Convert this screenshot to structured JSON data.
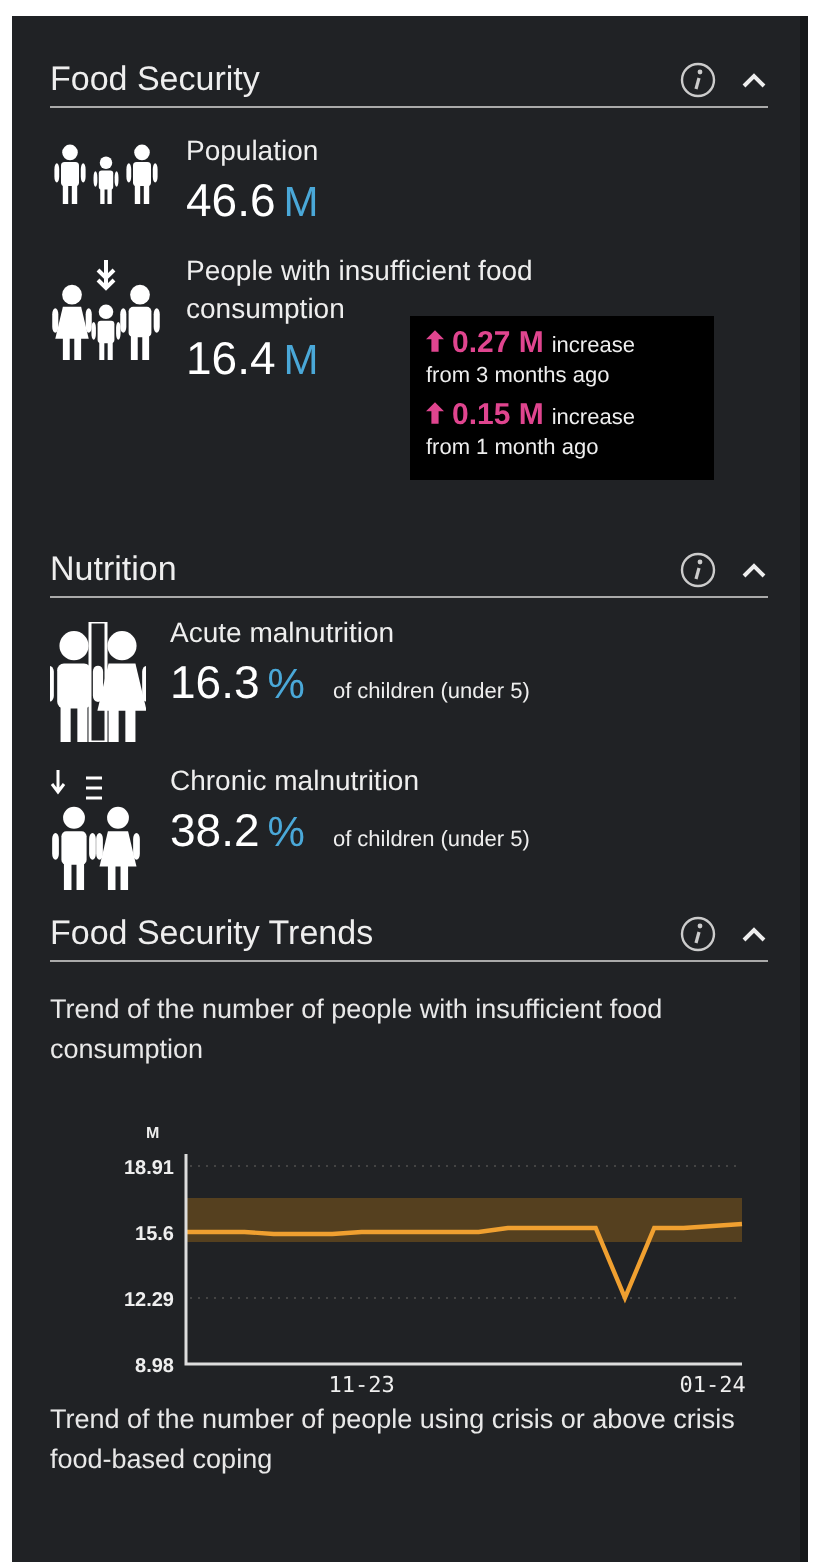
{
  "sections": [
    {
      "title": "Food Security",
      "kind": "stats",
      "items": [
        {
          "label": "Population",
          "value": "46.6",
          "unit": "M"
        },
        {
          "label": "People with insufficient food consumption",
          "value": "16.4",
          "unit": "M",
          "tooltip": [
            {
              "amount": "0.27 M",
              "word": "increase",
              "period": "from 3 months ago"
            },
            {
              "amount": "0.15 M",
              "word": "increase",
              "period": "from 1 month ago"
            }
          ]
        }
      ]
    },
    {
      "title": "Nutrition",
      "kind": "stats",
      "items": [
        {
          "label": "Acute malnutrition",
          "value": "16.3",
          "unit": "%",
          "note": "of children (under 5)"
        },
        {
          "label": "Chronic malnutrition",
          "value": "38.2",
          "unit": "%",
          "note": "of children (under 5)"
        }
      ]
    },
    {
      "title": "Food Security Trends",
      "kind": "trends",
      "charts": [
        {
          "caption": "Trend of the number of people with insufficient food consumption",
          "chart_data": {
            "type": "line",
            "ylabel": "M",
            "categories": [
              null,
              null,
              null,
              null,
              null,
              null,
              "11-23",
              null,
              null,
              null,
              null,
              null,
              null,
              null,
              null,
              null,
              null,
              null,
              "01-24",
              null
            ],
            "series": [
              {
                "color": "#f0a030",
                "values": [
                  15.6,
                  15.6,
                  15.6,
                  15.5,
                  15.5,
                  15.5,
                  15.6,
                  15.6,
                  15.6,
                  15.6,
                  15.6,
                  15.8,
                  15.8,
                  15.8,
                  15.8,
                  12.3,
                  15.8,
                  15.8,
                  15.9,
                  16.0
                ]
              }
            ],
            "ylim": [
              8.98,
              18.91
            ],
            "yticks": [
              8.98,
              12.29,
              15.6,
              18.91
            ]
          }
        },
        {
          "caption": "Trend of the number of people using crisis or above crisis food-based coping"
        }
      ]
    }
  ]
}
